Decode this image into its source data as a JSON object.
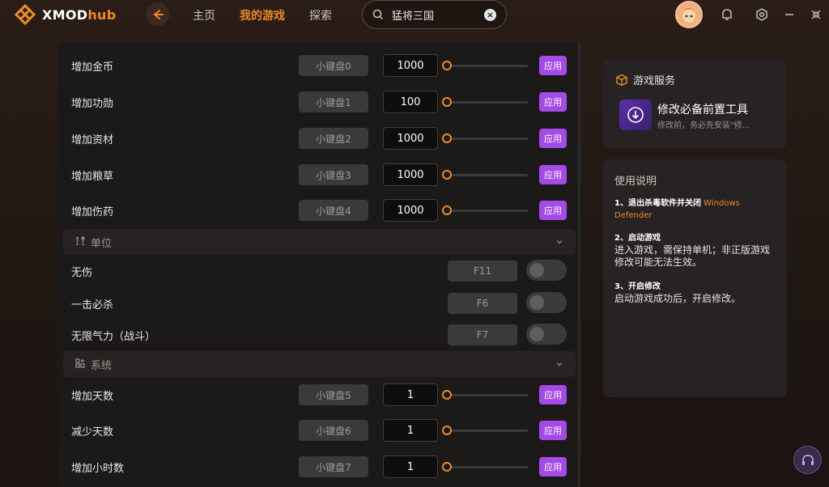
{
  "app": {
    "name_main": "XMOD",
    "name_sub": "hub"
  },
  "nav": {
    "home": "主页",
    "my_games": "我的游戏",
    "explore": "探索"
  },
  "search": {
    "query": "猛将三国"
  },
  "cheats_resource": [
    {
      "label": "增加金币",
      "key": "小键盘0",
      "value": "1000",
      "apply": "应用"
    },
    {
      "label": "增加功勋",
      "key": "小键盘1",
      "value": "100",
      "apply": "应用"
    },
    {
      "label": "增加资材",
      "key": "小键盘2",
      "value": "1000",
      "apply": "应用"
    },
    {
      "label": "增加粮草",
      "key": "小键盘3",
      "value": "1000",
      "apply": "应用"
    },
    {
      "label": "增加伤药",
      "key": "小键盘4",
      "value": "1000",
      "apply": "应用"
    }
  ],
  "section_unit": {
    "title": "单位"
  },
  "cheats_unit": [
    {
      "label": "无伤",
      "key": "F11",
      "on": false
    },
    {
      "label": "一击必杀",
      "key": "F6",
      "on": false
    },
    {
      "label": "无限气力（战斗）",
      "key": "F7",
      "on": false
    }
  ],
  "section_system": {
    "title": "系统"
  },
  "cheats_system": [
    {
      "label": "增加天数",
      "key": "小键盘5",
      "value": "1",
      "apply": "应用"
    },
    {
      "label": "减少天数",
      "key": "小键盘6",
      "value": "1",
      "apply": "应用"
    },
    {
      "label": "增加小时数",
      "key": "小键盘7",
      "value": "1",
      "apply": "应用"
    }
  ],
  "service": {
    "title": "游戏服务",
    "tool_title": "修改必备前置工具",
    "tool_sub": "修改前，务必先安装\"修..."
  },
  "guide": {
    "title": "使用说明",
    "s1_head": "1、退出杀毒软件并关闭",
    "s1_orange": "Windows Defender",
    "s2_head": "2、启动游戏",
    "s2_body": "进入游戏，需保持单机；非正版游戏修改可能无法生效。",
    "s3_head": "3、开启修改",
    "s3_body": "启动游戏成功后，开启修改。"
  },
  "colors": {
    "accent": "#f08a24",
    "apply": "#a44ae8"
  }
}
